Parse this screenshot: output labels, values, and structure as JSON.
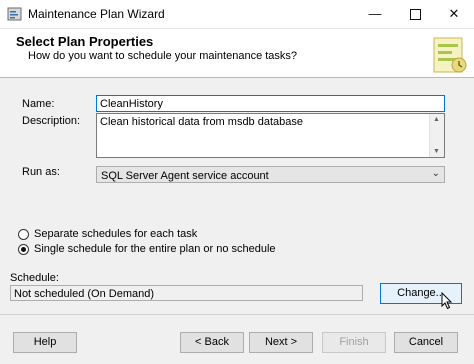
{
  "window": {
    "title": "Maintenance Plan Wizard",
    "minimize_glyph": "—",
    "close_glyph": "✕"
  },
  "header": {
    "title": "Select Plan Properties",
    "subtitle": "How do you want to schedule your maintenance tasks?"
  },
  "form": {
    "name_label": "Name:",
    "name_value": "CleanHistory",
    "description_label": "Description:",
    "description_value": "Clean historical data from msdb database",
    "run_as_label": "Run as:",
    "run_as_value": "SQL Server Agent service account"
  },
  "schedule_options": {
    "separate_label": "Separate schedules for each task",
    "single_label": "Single schedule for the entire plan or no schedule",
    "selected": "single"
  },
  "schedule": {
    "label": "Schedule:",
    "value": "Not scheduled (On Demand)",
    "change_button": "Change..."
  },
  "footer": {
    "help_button": "Help",
    "back_button": "< Back",
    "next_button": "Next >",
    "finish_button": "Finish",
    "cancel_button": "Cancel"
  },
  "colors": {
    "accent": "#0078d7",
    "dialog_bg": "#f0f0f0"
  }
}
